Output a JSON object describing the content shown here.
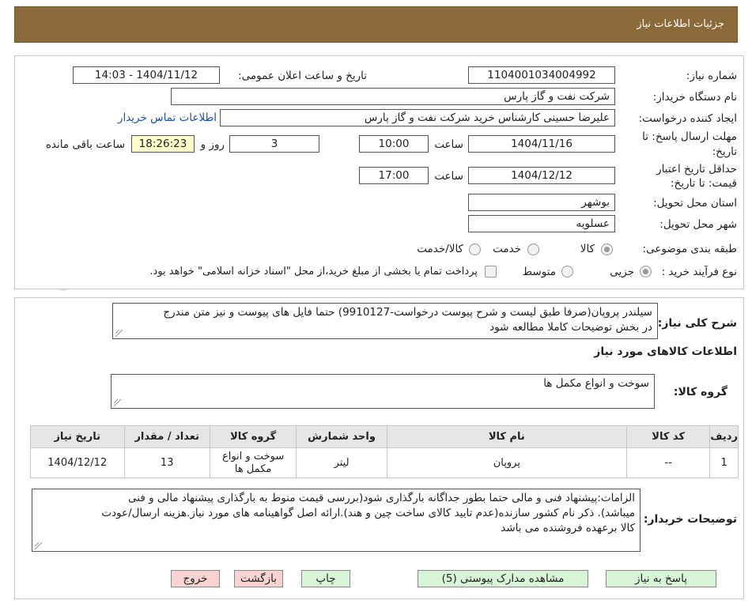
{
  "header": {
    "title": "جزئیات اطلاعات نیاز"
  },
  "watermark": {
    "text": "AriaTender.neT"
  },
  "form": {
    "need_number_label": "شماره نیاز:",
    "need_number": "1104001034004992",
    "announce_label": "تاریخ و ساعت اعلان عمومی:",
    "announce_value": "1404/11/12 - 14:03",
    "buyer_org_label": "نام دستگاه خریدار:",
    "buyer_org": "شرکت نفت و گاز پارس",
    "creator_label": "ایجاد کننده درخواست:",
    "creator": "علیرضا حسینی کارشناس خرید شرکت نفت و گاز پارس",
    "contact_link": "اطلاعات تماس خریدار",
    "deadline_label_1": "مهلت ارسال پاسخ: تا",
    "deadline_label_2": "تاریخ:",
    "deadline_date": "1404/11/16",
    "time_label": "ساعت",
    "deadline_time": "10:00",
    "days_value": "3",
    "days_label": "روز و",
    "remaining_time": "18:26:23",
    "remaining_label": "ساعت باقی مانده",
    "validity_label_1": "حداقل تاریخ اعتبار",
    "validity_label_2": "قیمت: تا تاریخ:",
    "validity_date": "1404/12/12",
    "validity_time": "17:00",
    "province_label": "استان محل تحویل:",
    "province": "بوشهر",
    "city_label": "شهر محل تحویل:",
    "city": "عسلویه",
    "category_label": "طبقه بندی موضوعی:",
    "category_options": [
      "کالا",
      "خدمت",
      "کالا/خدمت"
    ],
    "category_selected": "کالا",
    "process_label": "نوع فرآیند خرید :",
    "process_options": [
      "جزیی",
      "متوسط"
    ],
    "process_selected": "جزیی",
    "payment_note": "پرداخت تمام یا بخشی از مبلغ خرید،از محل \"اسناد خزانه اسلامی\" خواهد بود."
  },
  "description": {
    "label": "شرح کلی نیاز:",
    "text_line1": "سیلندر پروپان(صرفا طبق لیست و شرح پیوست درخواست-9910127) حتما فایل های پیوست و نیز متن مندرج",
    "text_line2": "در بخش توضیحات کاملا مطالعه شود"
  },
  "goods": {
    "section_title": "اطلاعات کالاهای مورد نیاز",
    "group_label": "گروه کالا:",
    "group_value": "سوخت و انواع مکمل ها",
    "columns": [
      "ردیف",
      "کد کالا",
      "نام کالا",
      "واحد شمارش",
      "گروه کالا",
      "تعداد / مقدار",
      "تاریخ نیاز"
    ],
    "rows": [
      {
        "row": "1",
        "code": "--",
        "name": "پروپان",
        "unit": "لیتر",
        "group_line1": "سوخت و انواع",
        "group_line2": "مکمل ها",
        "qty": "13",
        "date": "1404/12/12"
      }
    ]
  },
  "buyer_notes": {
    "label": "توضیحات خریدار:",
    "line1": "الزامات:پیشنهاد فنی و مالی حتما  بطور جداگانه بارگذاری شود(بررسی قیمت منوط به بارگذاری پیشنهاد مالی و فنی",
    "line2": "میباشد). ذکر نام کشور سازنده(عدم تایید کالای ساخت چین و هند).ارائه اصل گواهینامه های مورد نیاز.هزینه ارسال/عودت",
    "line3": "کالا برعهده فروشنده می باشد"
  },
  "buttons": {
    "reply": "پاسخ به نیاز",
    "attachments": "مشاهده مدارک پیوستی (5)",
    "print": "چاپ",
    "back": "بازگشت",
    "exit": "خروج"
  },
  "colors": {
    "header_bg": "#8a6a3a",
    "link": "#1a4fb0",
    "green_button": "#d8f5d8",
    "pink_button": "#f9d2d2",
    "remaining_bg": "#ffffcc"
  }
}
